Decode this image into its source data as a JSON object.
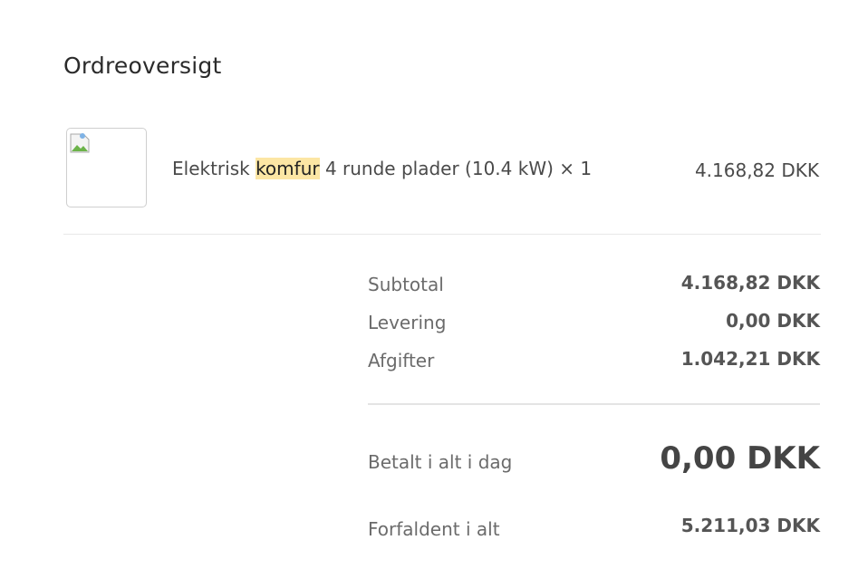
{
  "order": {
    "title": "Ordreoversigt",
    "item": {
      "name_before": "Elektrisk ",
      "name_highlight": "komfur",
      "name_after": " 4 runde plader (10.4 kW) × 1",
      "price": "4.168,82 DKK",
      "image_icon": "broken-image-icon"
    },
    "summary": {
      "subtotal_label": "Subtotal",
      "subtotal_value": "4.168,82 DKK",
      "delivery_label": "Levering",
      "delivery_value": "0,00 DKK",
      "fees_label": "Afgifter",
      "fees_value": "1.042,21 DKK",
      "paid_today_label": "Betalt i alt i dag",
      "paid_today_value": "0,00 DKK",
      "due_label": "Forfaldent i alt",
      "due_value": "5.211,03 DKK"
    }
  },
  "colors": {
    "highlight": "#fce6a4",
    "text": "#4a4a4a",
    "muted": "#6b6b6b",
    "border": "#cfcfcf"
  }
}
